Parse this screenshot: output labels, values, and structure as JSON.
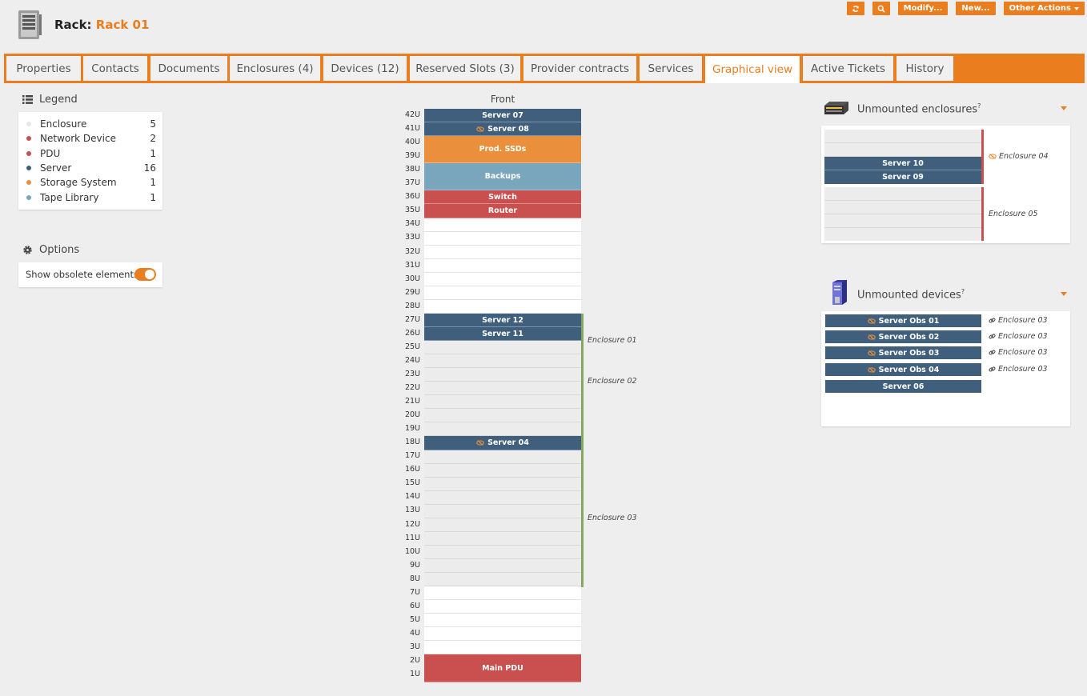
{
  "header": {
    "label": "Rack:",
    "name": "Rack 01",
    "actions": {
      "modify": "Modify...",
      "new": "New...",
      "other": "Other Actions"
    }
  },
  "tabs": [
    {
      "label": "Properties"
    },
    {
      "label": "Contacts"
    },
    {
      "label": "Documents"
    },
    {
      "label": "Enclosures (4)"
    },
    {
      "label": "Devices (12)"
    },
    {
      "label": "Reserved Slots (3)"
    },
    {
      "label": "Provider contracts"
    },
    {
      "label": "Services"
    },
    {
      "label": "Graphical view"
    },
    {
      "label": "Active Tickets"
    },
    {
      "label": "History"
    }
  ],
  "legend": {
    "title": "Legend",
    "items": [
      {
        "label": "Enclosure",
        "count": "5",
        "color": "#e8e8e8"
      },
      {
        "label": "Network Device",
        "count": "2",
        "color": "#c9504f"
      },
      {
        "label": "PDU",
        "count": "1",
        "color": "#c9504f"
      },
      {
        "label": "Server",
        "count": "16",
        "color": "#3f5f7c"
      },
      {
        "label": "Storage System",
        "count": "1",
        "color": "#ea8f3b"
      },
      {
        "label": "Tape Library",
        "count": "1",
        "color": "#7aa6bd"
      }
    ]
  },
  "options": {
    "title": "Options",
    "show_obsolete": "Show obsolete elements",
    "help": "?",
    "enabled": true
  },
  "rack": {
    "front_label": "Front",
    "units": [
      "42U",
      "41U",
      "40U",
      "39U",
      "38U",
      "37U",
      "36U",
      "35U",
      "34U",
      "33U",
      "32U",
      "31U",
      "30U",
      "29U",
      "28U",
      "27U",
      "26U",
      "25U",
      "24U",
      "23U",
      "22U",
      "21U",
      "20U",
      "19U",
      "18U",
      "17U",
      "16U",
      "15U",
      "14U",
      "13U",
      "12U",
      "11U",
      "10U",
      "9U",
      "8U",
      "7U",
      "6U",
      "5U",
      "4U",
      "3U",
      "2U",
      "1U"
    ],
    "devices": [
      {
        "label": "Server 07",
        "color": "#3f5f7c",
        "obsolete": false
      },
      {
        "label": "Server 08",
        "color": "#3f5f7c",
        "obsolete": true
      },
      {
        "label": "Prod. SSDs",
        "color": "#ea8f3b",
        "obsolete": false
      },
      {
        "label": "Backups",
        "color": "#7aa6bd",
        "obsolete": false
      },
      {
        "label": "Switch",
        "color": "#c9504f",
        "obsolete": false
      },
      {
        "label": "Router",
        "color": "#c9504f",
        "obsolete": false
      },
      {
        "label": "Server 12",
        "color": "#3f5f7c",
        "obsolete": false
      },
      {
        "label": "Server 11",
        "color": "#3f5f7c",
        "obsolete": false
      },
      {
        "label": "Server 04",
        "color": "#3f5f7c",
        "obsolete": true
      },
      {
        "label": "Main PDU",
        "color": "#c9504f",
        "obsolete": false
      }
    ],
    "enclosures": [
      "Enclosure 01",
      "Enclosure 02",
      "Enclosure 03"
    ]
  },
  "unmounted_enclosures": {
    "title": "Unmounted enclosures",
    "help": "?",
    "enclosures": [
      {
        "label": "Enclosure 04",
        "obsolete": true,
        "devices": [
          "Server 10",
          "Server 09"
        ]
      },
      {
        "label": "Enclosure 05",
        "obsolete": false,
        "devices": []
      }
    ]
  },
  "unmounted_devices": {
    "title": "Unmounted devices",
    "help": "?",
    "items": [
      {
        "label": "Server Obs 01",
        "obsolete": true,
        "link": "Enclosure 03"
      },
      {
        "label": "Server Obs 02",
        "obsolete": true,
        "link": "Enclosure 03"
      },
      {
        "label": "Server Obs 03",
        "obsolete": true,
        "link": "Enclosure 03"
      },
      {
        "label": "Server Obs 04",
        "obsolete": true,
        "link": "Enclosure 03"
      },
      {
        "label": "Server 06",
        "obsolete": false,
        "link": ""
      }
    ]
  }
}
